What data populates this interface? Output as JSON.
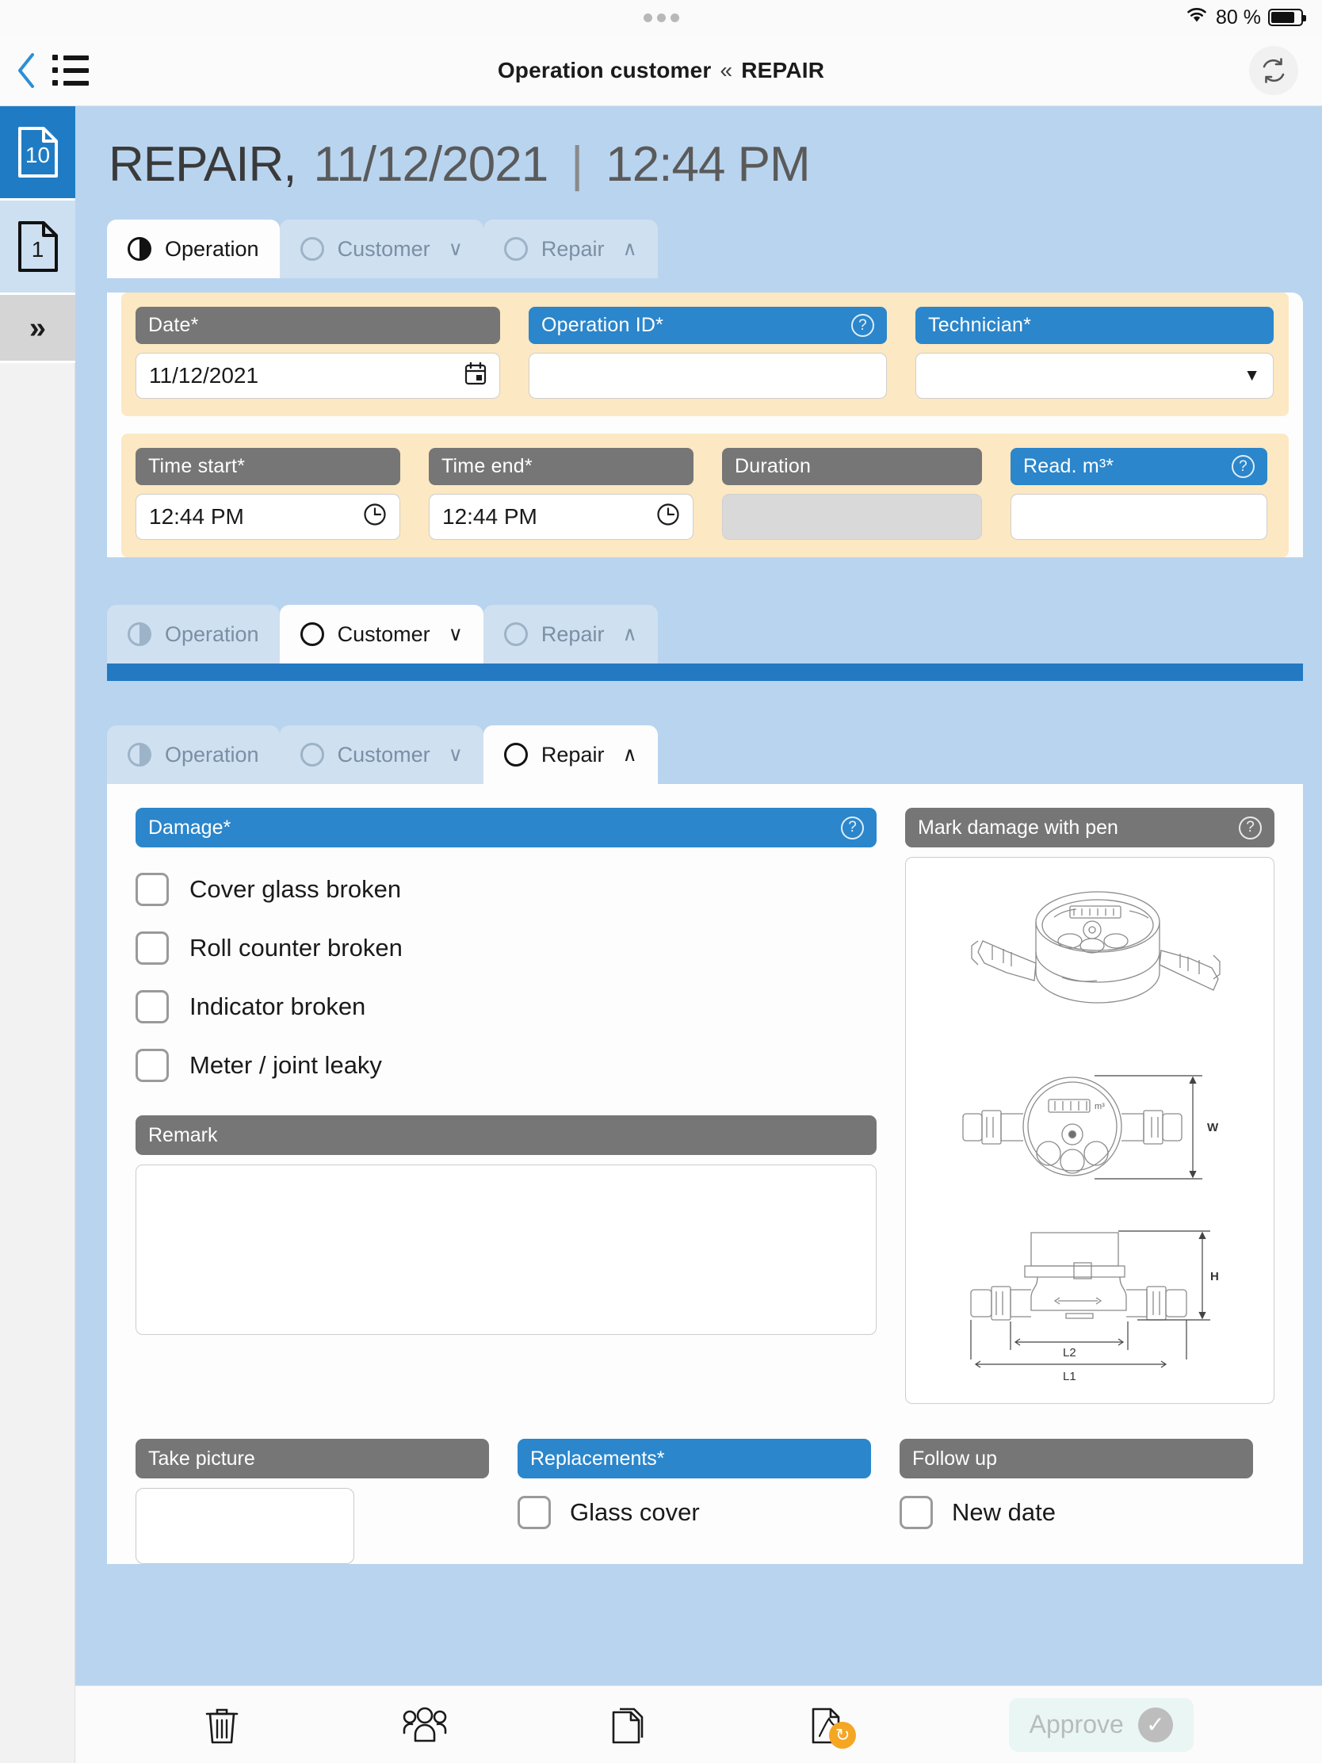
{
  "status_bar": {
    "wifi_icon": "wifi-icon",
    "battery_percent": "80 %",
    "battery_icon": "battery-icon"
  },
  "nav": {
    "back_icon": "chevron-left-icon",
    "menu_icon": "list-menu-icon",
    "title_main": "Operation customer",
    "title_separator": "«",
    "title_sub": "REPAIR",
    "refresh_icon": "refresh-icon"
  },
  "rail": {
    "items": [
      {
        "name": "document-badge-10",
        "badge": "10",
        "icon": "document-icon",
        "state": "active"
      },
      {
        "name": "document-badge-1",
        "badge": "1",
        "icon": "document-icon",
        "state": "light"
      }
    ],
    "expand_label": "»",
    "expand_icon": "double-chevron-right-icon"
  },
  "header": {
    "title": "REPAIR,",
    "date": "11/12/2021",
    "separator": "|",
    "time": "12:44 PM"
  },
  "tabs_operation": [
    {
      "label": "Operation",
      "icon": "half-circle-icon",
      "selected": true,
      "chevron": ""
    },
    {
      "label": "Customer",
      "icon": "circle-icon",
      "selected": false,
      "chevron": "∨"
    },
    {
      "label": "Repair",
      "icon": "circle-icon",
      "selected": false,
      "chevron": "∧"
    }
  ],
  "tabs_customer": [
    {
      "label": "Operation",
      "icon": "half-circle-icon",
      "selected": false,
      "chevron": ""
    },
    {
      "label": "Customer",
      "icon": "circle-icon",
      "selected": true,
      "chevron": "∨"
    },
    {
      "label": "Repair",
      "icon": "circle-icon",
      "selected": false,
      "chevron": "∧"
    }
  ],
  "tabs_repair": [
    {
      "label": "Operation",
      "icon": "half-circle-icon",
      "selected": false,
      "chevron": ""
    },
    {
      "label": "Customer",
      "icon": "circle-icon",
      "selected": false,
      "chevron": "∨"
    },
    {
      "label": "Repair",
      "icon": "circle-icon",
      "selected": true,
      "chevron": "∧"
    }
  ],
  "operation_form": {
    "row1": [
      {
        "label": "Date*",
        "style": "grey",
        "help": false,
        "value": "11/12/2021",
        "control": "date",
        "icon": "calendar-icon"
      },
      {
        "label": "Operation ID*",
        "style": "blue",
        "help": true,
        "value": "",
        "control": "text",
        "icon": ""
      },
      {
        "label": "Technician*",
        "style": "blue",
        "help": false,
        "value": "",
        "control": "select",
        "icon": "caret-down-icon"
      }
    ],
    "row2": [
      {
        "label": "Time start*",
        "style": "grey",
        "help": false,
        "value": "12:44 PM",
        "control": "time",
        "icon": "clock-icon"
      },
      {
        "label": "Time end*",
        "style": "grey",
        "help": false,
        "value": "12:44 PM",
        "control": "time",
        "icon": "clock-icon"
      },
      {
        "label": "Duration",
        "style": "grey",
        "help": false,
        "value": "",
        "control": "readonly",
        "icon": ""
      },
      {
        "label": "Read. m³*",
        "style": "blue",
        "help": true,
        "value": "",
        "control": "text",
        "icon": ""
      }
    ],
    "help_icon": "question-mark-icon"
  },
  "repair_form": {
    "damage_label": "Damage*",
    "damage_help_icon": "question-mark-icon",
    "damage_options": [
      {
        "label": "Cover glass broken",
        "checked": false
      },
      {
        "label": "Roll counter broken",
        "checked": false
      },
      {
        "label": "Indicator broken",
        "checked": false
      },
      {
        "label": "Meter / joint leaky",
        "checked": false
      }
    ],
    "remark_label": "Remark",
    "remark_value": "",
    "mark_damage_label": "Mark damage with pen",
    "mark_damage_help_icon": "question-mark-icon",
    "drawing": {
      "name": "water-meter-technical-drawing",
      "dimension_labels": [
        "W",
        "H",
        "L2",
        "L1"
      ],
      "display_text": "m³"
    },
    "take_picture_label": "Take picture",
    "replacements_label": "Replacements*",
    "replacements_option": "Glass cover",
    "follow_up_label": "Follow up",
    "follow_up_option": "New date"
  },
  "toolbar": {
    "items": [
      {
        "name": "delete-button",
        "icon": "trash-icon"
      },
      {
        "name": "contacts-button",
        "icon": "people-icon"
      },
      {
        "name": "copy-button",
        "icon": "copy-icon"
      },
      {
        "name": "pdf-button",
        "icon": "pdf-refresh-icon"
      }
    ],
    "approve_label": "Approve",
    "approve_icon": "check-circle-icon"
  },
  "colors": {
    "accent_blue": "#2b86cb",
    "rail_active": "#1f7cc4",
    "grey_header": "#767676",
    "cream": "#fce8c2",
    "page_bg": "#b9d4ef",
    "bluebar": "#2379c2"
  }
}
